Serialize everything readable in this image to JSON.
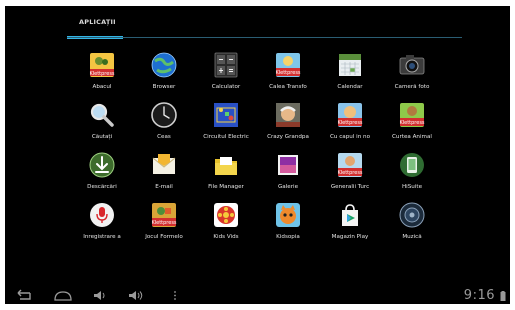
{
  "tab": {
    "label": "APLICAȚII"
  },
  "apps": [
    {
      "label": "Abacul",
      "icon": "klettpress-abacus-icon"
    },
    {
      "label": "Browser",
      "icon": "globe-icon"
    },
    {
      "label": "Calculator",
      "icon": "calculator-icon"
    },
    {
      "label": "Calea Transfo",
      "icon": "klettpress-transform-icon"
    },
    {
      "label": "Calendar",
      "icon": "calendar-icon"
    },
    {
      "label": "Cameră foto",
      "icon": "camera-icon"
    },
    {
      "label": "Căutați",
      "icon": "magnifier-icon"
    },
    {
      "label": "Ceas",
      "icon": "clock-icon"
    },
    {
      "label": "Circuitul Electric",
      "icon": "circuit-icon"
    },
    {
      "label": "Crazy Grandpa",
      "icon": "crazy-grandpa-icon"
    },
    {
      "label": "Cu capul in no",
      "icon": "klettpress-clouds-icon"
    },
    {
      "label": "Curtea Animal",
      "icon": "klettpress-animals-icon"
    },
    {
      "label": "Descărcări",
      "icon": "download-icon"
    },
    {
      "label": "E-mail",
      "icon": "email-icon"
    },
    {
      "label": "File Manager",
      "icon": "folder-icon"
    },
    {
      "label": "Galerie",
      "icon": "gallery-icon"
    },
    {
      "label": "Generalii Turc",
      "icon": "klettpress-generals-icon"
    },
    {
      "label": "HiSuite",
      "icon": "phone-sync-icon"
    },
    {
      "label": "Înregistrare a",
      "icon": "microphone-icon"
    },
    {
      "label": "Jocul Formelo",
      "icon": "klettpress-shapes-icon"
    },
    {
      "label": "Kids Vids",
      "icon": "film-reel-icon"
    },
    {
      "label": "Kidsopia",
      "icon": "kidsopia-fox-icon"
    },
    {
      "label": "Magazin Play",
      "icon": "play-store-icon"
    },
    {
      "label": "Muzică",
      "icon": "speaker-icon"
    }
  ],
  "statusbar": {
    "time": "9:16",
    "nav": [
      "back-icon",
      "home-icon",
      "volume-down-icon",
      "volume-up-icon",
      "menu-icon"
    ]
  },
  "colors": {
    "accent": "#33b5e5",
    "background": "#000000"
  }
}
